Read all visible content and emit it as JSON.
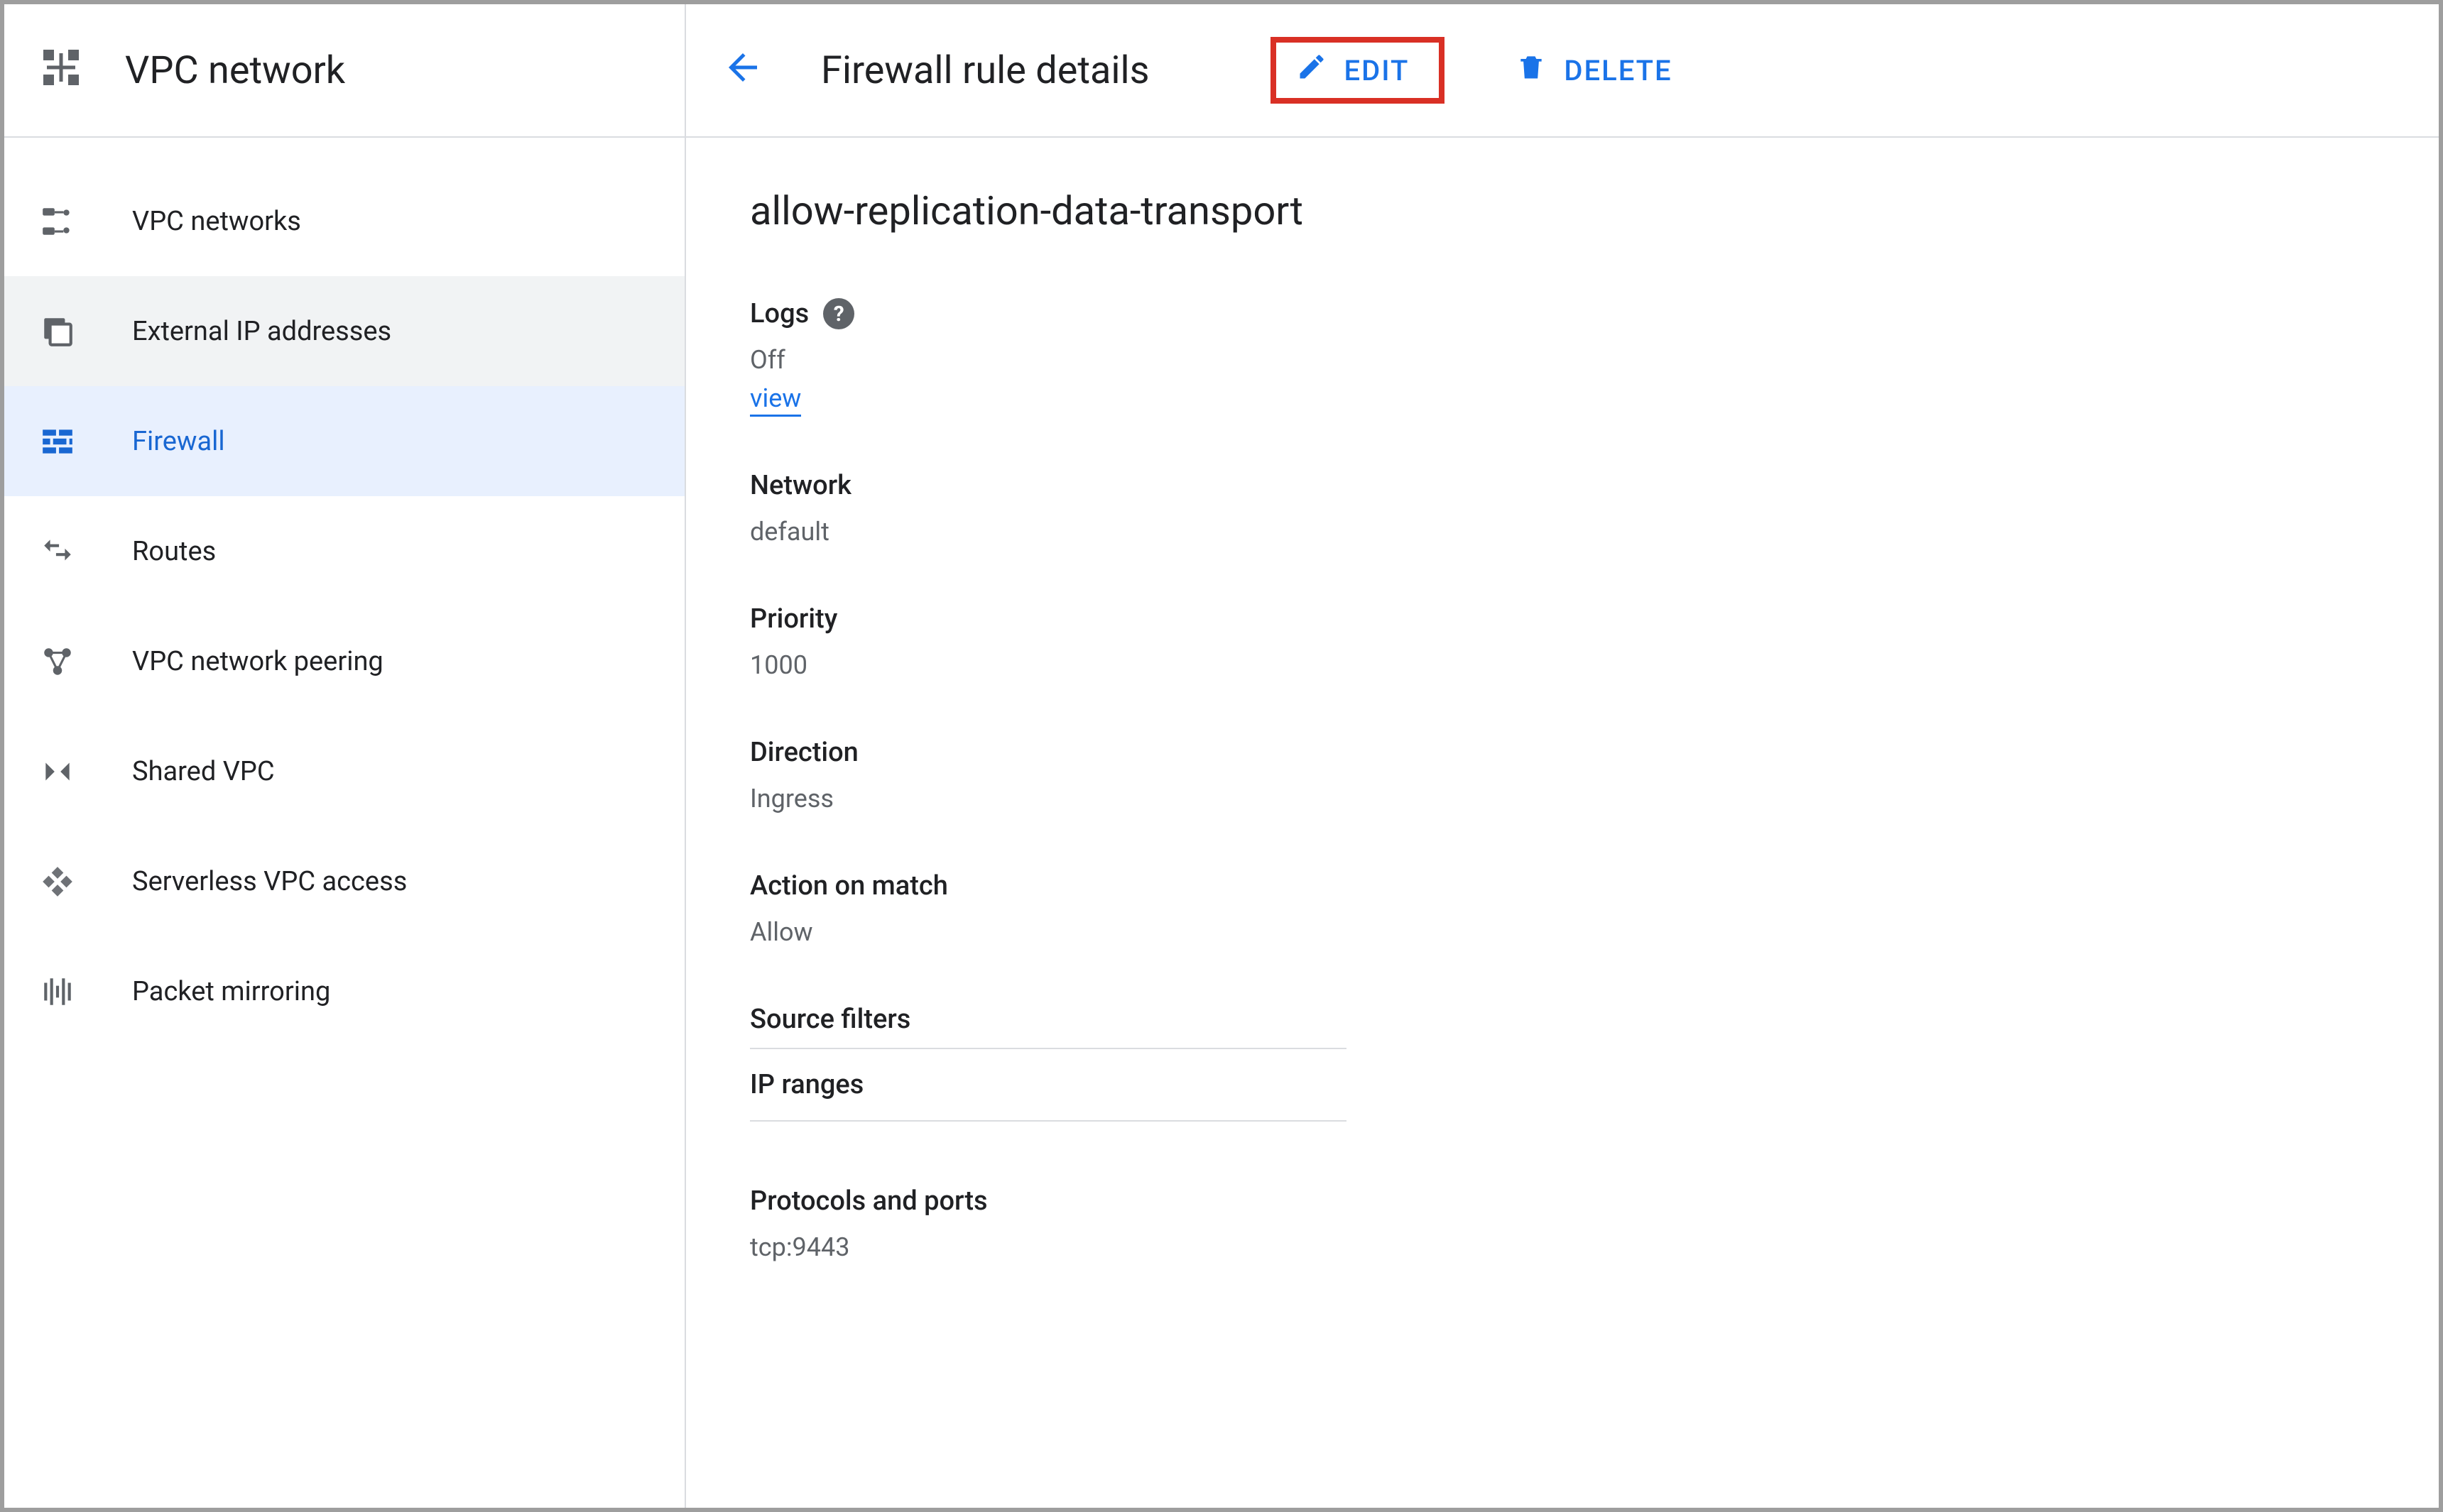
{
  "sidebar": {
    "title": "VPC network",
    "items": [
      {
        "label": "VPC networks"
      },
      {
        "label": "External IP addresses"
      },
      {
        "label": "Firewall"
      },
      {
        "label": "Routes"
      },
      {
        "label": "VPC network peering"
      },
      {
        "label": "Shared VPC"
      },
      {
        "label": "Serverless VPC access"
      },
      {
        "label": "Packet mirroring"
      }
    ]
  },
  "header": {
    "page_title": "Firewall rule details",
    "edit_label": "EDIT",
    "delete_label": "DELETE"
  },
  "rule": {
    "name": "allow-replication-data-transport",
    "logs": {
      "label": "Logs",
      "value": "Off",
      "view_label": "view"
    },
    "network": {
      "label": "Network",
      "value": "default"
    },
    "priority": {
      "label": "Priority",
      "value": "1000"
    },
    "direction": {
      "label": "Direction",
      "value": "Ingress"
    },
    "action": {
      "label": "Action on match",
      "value": "Allow"
    },
    "source_filters": {
      "label": "Source filters",
      "ip_ranges_label": "IP ranges"
    },
    "protocols": {
      "label": "Protocols and ports",
      "value": "tcp:9443"
    }
  },
  "colors": {
    "accent": "#1a73e8",
    "highlight_box": "#d93025"
  }
}
